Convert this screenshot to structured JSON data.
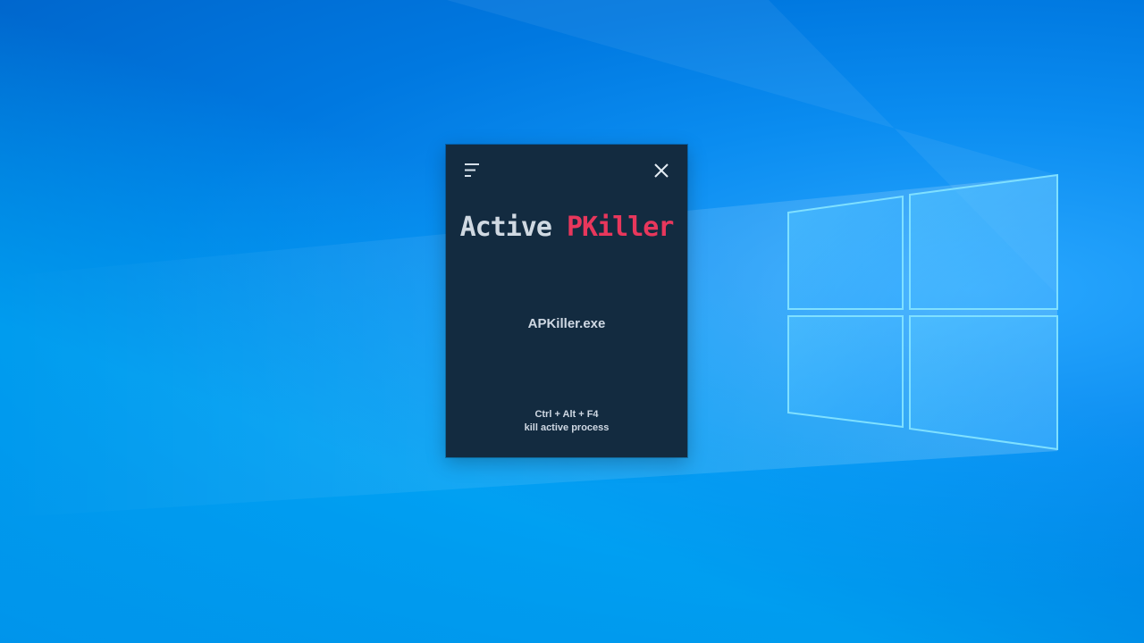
{
  "window": {
    "title_part_1": "Active",
    "title_part_2": "PKiller",
    "process_name": "APKiller.exe",
    "hotkey": "Ctrl + Alt + F4",
    "hotkey_description": "kill active process",
    "menu_icon": "hamburger-menu-icon",
    "close_icon": "close-icon"
  },
  "colors": {
    "window_background": "#132b40",
    "title_primary": "#d0d9e2",
    "title_accent": "#e8375c",
    "text": "#cfd8e3",
    "desktop_blue": "#0a8cf0"
  }
}
